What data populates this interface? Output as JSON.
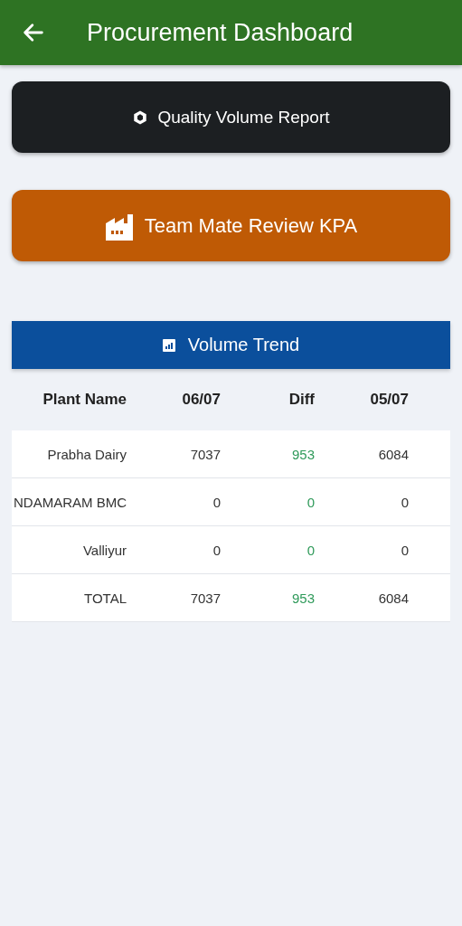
{
  "app_bar": {
    "title": "Procurement Dashboard"
  },
  "actions": [
    {
      "label": "Quality Volume Report",
      "kind": "report"
    },
    {
      "label": "Team Mate Review KPA",
      "kind": "review"
    }
  ],
  "volume_trend": {
    "title": "Volume Trend",
    "columns": [
      "Plant Name",
      "06/07",
      "Diff",
      "05/07"
    ],
    "rows": [
      {
        "plant": "Prabha Dairy",
        "today": "7037",
        "diff": "953",
        "previous": "6084"
      },
      {
        "plant": "NDAMARAM BMC",
        "today": "0",
        "diff": "0",
        "previous": "0"
      },
      {
        "plant": "Valliyur",
        "today": "0",
        "diff": "0",
        "previous": "0"
      },
      {
        "plant": "TOTAL",
        "today": "7037",
        "diff": "953",
        "previous": "6084"
      }
    ]
  }
}
